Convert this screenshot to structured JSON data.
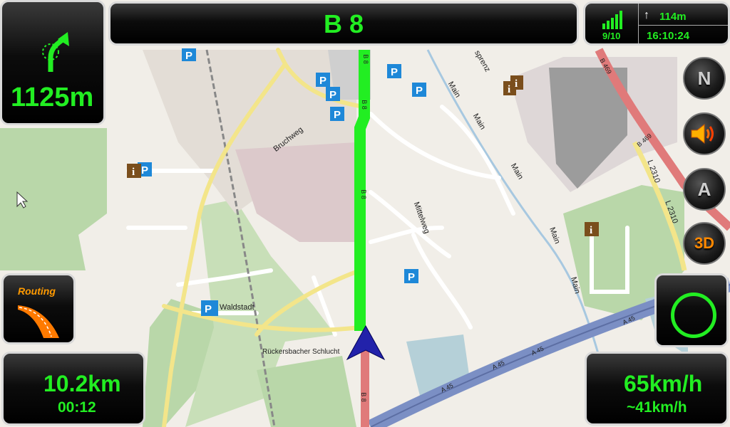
{
  "street": {
    "name": "B 8"
  },
  "maneuver": {
    "distance": "1125m"
  },
  "gps": {
    "satellites": "9/10"
  },
  "next_turn": {
    "distance": "114m"
  },
  "clock": {
    "time": "16:10:24"
  },
  "trip": {
    "remaining_distance": "10.2km",
    "remaining_time": "00:12"
  },
  "speed": {
    "current": "65km/h",
    "average": "~41km/h"
  },
  "buttons": {
    "north": "N",
    "autozoom": "A",
    "view3d": "3D",
    "routing": "Routing"
  },
  "map_labels": {
    "b8_top": "B 8",
    "b8_mid": "B 8",
    "b8_low": "B 8",
    "b8_bottom": "B 8",
    "bruchweg": "Bruchweg",
    "mittelweg": "Mittelweg",
    "main1": "Main",
    "main2": "Main",
    "main3": "Main",
    "main4": "Main",
    "main5": "Main",
    "waldstadt": "Waldstadt",
    "schlucht": "Rückersbacher Schlucht",
    "l2310a": "L 2310",
    "l2310b": "L 2310",
    "b469": "B 469",
    "b469b": "B 469",
    "sprenz": "sprenz",
    "a45_1": "A 45",
    "a45_2": "A 45",
    "a45_3": "A 45",
    "a45_4": "A 45"
  },
  "colors": {
    "route": "#22ee22",
    "panel_text": "#22ee22",
    "cursor": "#2222aa",
    "motorway": "#7b8fc4"
  }
}
